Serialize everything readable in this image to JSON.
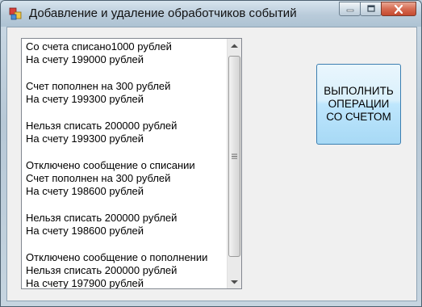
{
  "window": {
    "title": "Добавление и удаление обработчиков событий",
    "caption_buttons": [
      "minimize-icon",
      "maximize-icon",
      "close-icon"
    ]
  },
  "log": {
    "lines": [
      "Со счета списано1000 рублей",
      "На счету 199000 рублей",
      "",
      "Счет пополнен на 300 рублей",
      "На счету 199300 рублей",
      "",
      "Нельзя списать 200000 рублей",
      "На счету 199300 рублей",
      "",
      "Отключено сообщение о списании",
      "Счет пополнен на 300 рублей",
      "На счету 198600 рублей",
      "",
      "Нельзя списать 200000 рублей",
      "На счету 198600 рублей",
      "",
      "Отключено сообщение о пополнении",
      "Нельзя списать 200000 рублей",
      "На счету 197900 рублей"
    ]
  },
  "action_button": {
    "label": "ВЫПОЛНИТЬ ОПЕРАЦИИ СО СЧЕТОМ"
  }
}
